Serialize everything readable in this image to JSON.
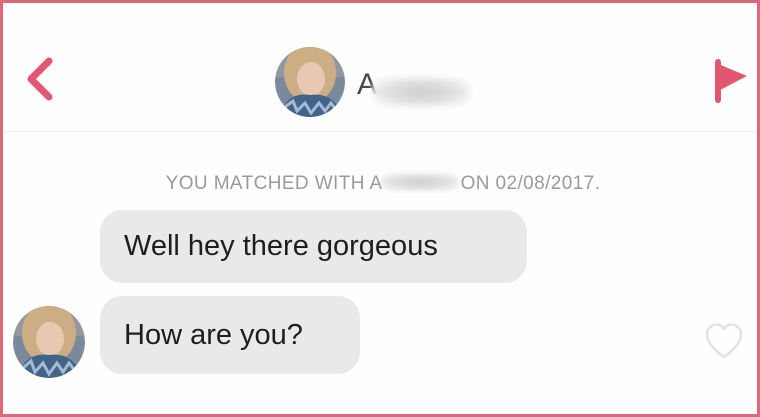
{
  "header": {
    "back_icon": "chevron-left-icon",
    "flag_icon": "flag-icon",
    "match_name_visible": "A",
    "accent_color": "#e3566f"
  },
  "match_notice": {
    "prefix": "YOU MATCHED WITH A",
    "suffix": "ON 02/08/2017."
  },
  "messages": [
    {
      "text": "Well hey there gorgeous"
    },
    {
      "text": "How are you?"
    }
  ],
  "message_actions": {
    "like_icon": "heart-outline-icon"
  }
}
